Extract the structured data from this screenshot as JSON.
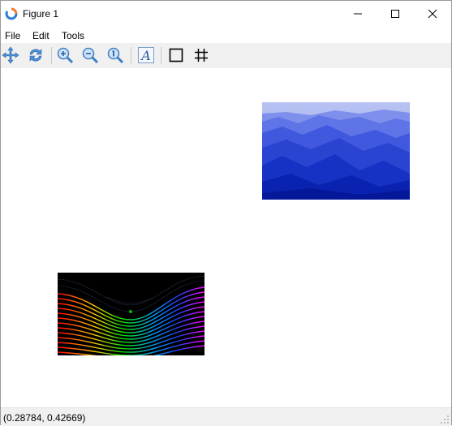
{
  "window": {
    "title": "Figure 1"
  },
  "menu": {
    "items": [
      "File",
      "Edit",
      "Tools"
    ]
  },
  "toolbar": {
    "buttons": [
      {
        "name": "pan-icon"
      },
      {
        "name": "refresh-icon"
      },
      {
        "name": "zoom-in-icon"
      },
      {
        "name": "zoom-out-icon"
      },
      {
        "name": "zoom-reset-icon"
      },
      {
        "name": "text-icon"
      },
      {
        "name": "square-icon"
      },
      {
        "name": "grid-icon"
      }
    ]
  },
  "canvas": {
    "images": [
      {
        "name": "mountains-image",
        "description_colors": [
          "#6f7fe6",
          "#2f47d8",
          "#0a22b8"
        ]
      },
      {
        "name": "rainbow-contour-image",
        "description_colors": [
          "#ff0000",
          "#ffff00",
          "#00ff00",
          "#0000ff",
          "#ff00ff"
        ]
      }
    ]
  },
  "status": {
    "coordinates": "(0.28784, 0.42669)"
  }
}
